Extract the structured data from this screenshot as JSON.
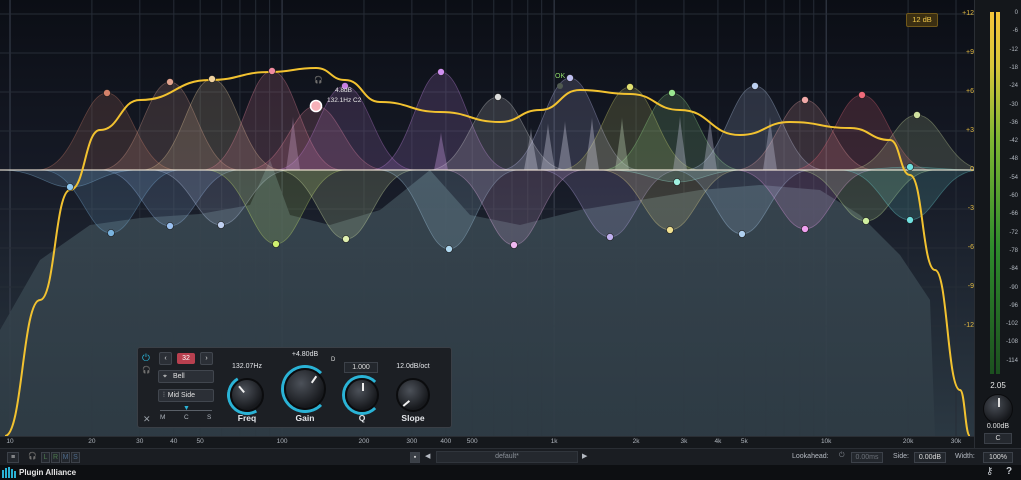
{
  "app": {
    "brand": "Plugin Alliance"
  },
  "display": {
    "range_badge": "12 dB",
    "tooltip_gain": "4.8dB",
    "tooltip_freq": "132.1Hz C2",
    "node_label": "OK",
    "freq_labels": [
      "10",
      "20",
      "30",
      "40",
      "50",
      "100",
      "200",
      "300",
      "400",
      "500",
      "1k",
      "2k",
      "3k",
      "4k",
      "5k",
      "10k",
      "20k",
      "30k"
    ],
    "gain_labels": [
      "+12",
      "+9",
      "+6",
      "+3",
      "0",
      "-3",
      "-6",
      "-9",
      "-12"
    ],
    "meter_labels": [
      "0",
      "-6",
      "-12",
      "-18",
      "-24",
      "-30",
      "-36",
      "-42",
      "-48",
      "-54",
      "-60",
      "-66",
      "-72",
      "-78",
      "-84",
      "-90",
      "-96",
      "-102",
      "-108",
      "-114"
    ]
  },
  "meter": {
    "value": "2.05",
    "output_gain": "0.00dB",
    "channel": "C"
  },
  "band_panel": {
    "band_number": "32",
    "filter_type": "Bell",
    "stereo_mode": "Mid Side",
    "ms_labels": [
      "M",
      "C",
      "S"
    ],
    "freq": {
      "label": "Freq",
      "value": "132.07Hz"
    },
    "gain": {
      "label": "Gain",
      "value": "+4.80dB"
    },
    "q": {
      "label": "Q",
      "value": "1.000"
    },
    "slope": {
      "label": "Slope",
      "value": "12.0dB/oct"
    },
    "dynamic_label": "D"
  },
  "bottom": {
    "preset": "default*",
    "lookahead_label": "Lookahead:",
    "lookahead_value": "0.00ms",
    "side_label": "Side:",
    "side_value": "0.00dB",
    "width_label": "Width:",
    "width_value": "100%",
    "channel_buttons": [
      "L",
      "R",
      "M",
      "S"
    ]
  },
  "colors": {
    "curve": "#f2c230",
    "accent": "#2ab3d6",
    "meter_label": "#e0b840"
  }
}
